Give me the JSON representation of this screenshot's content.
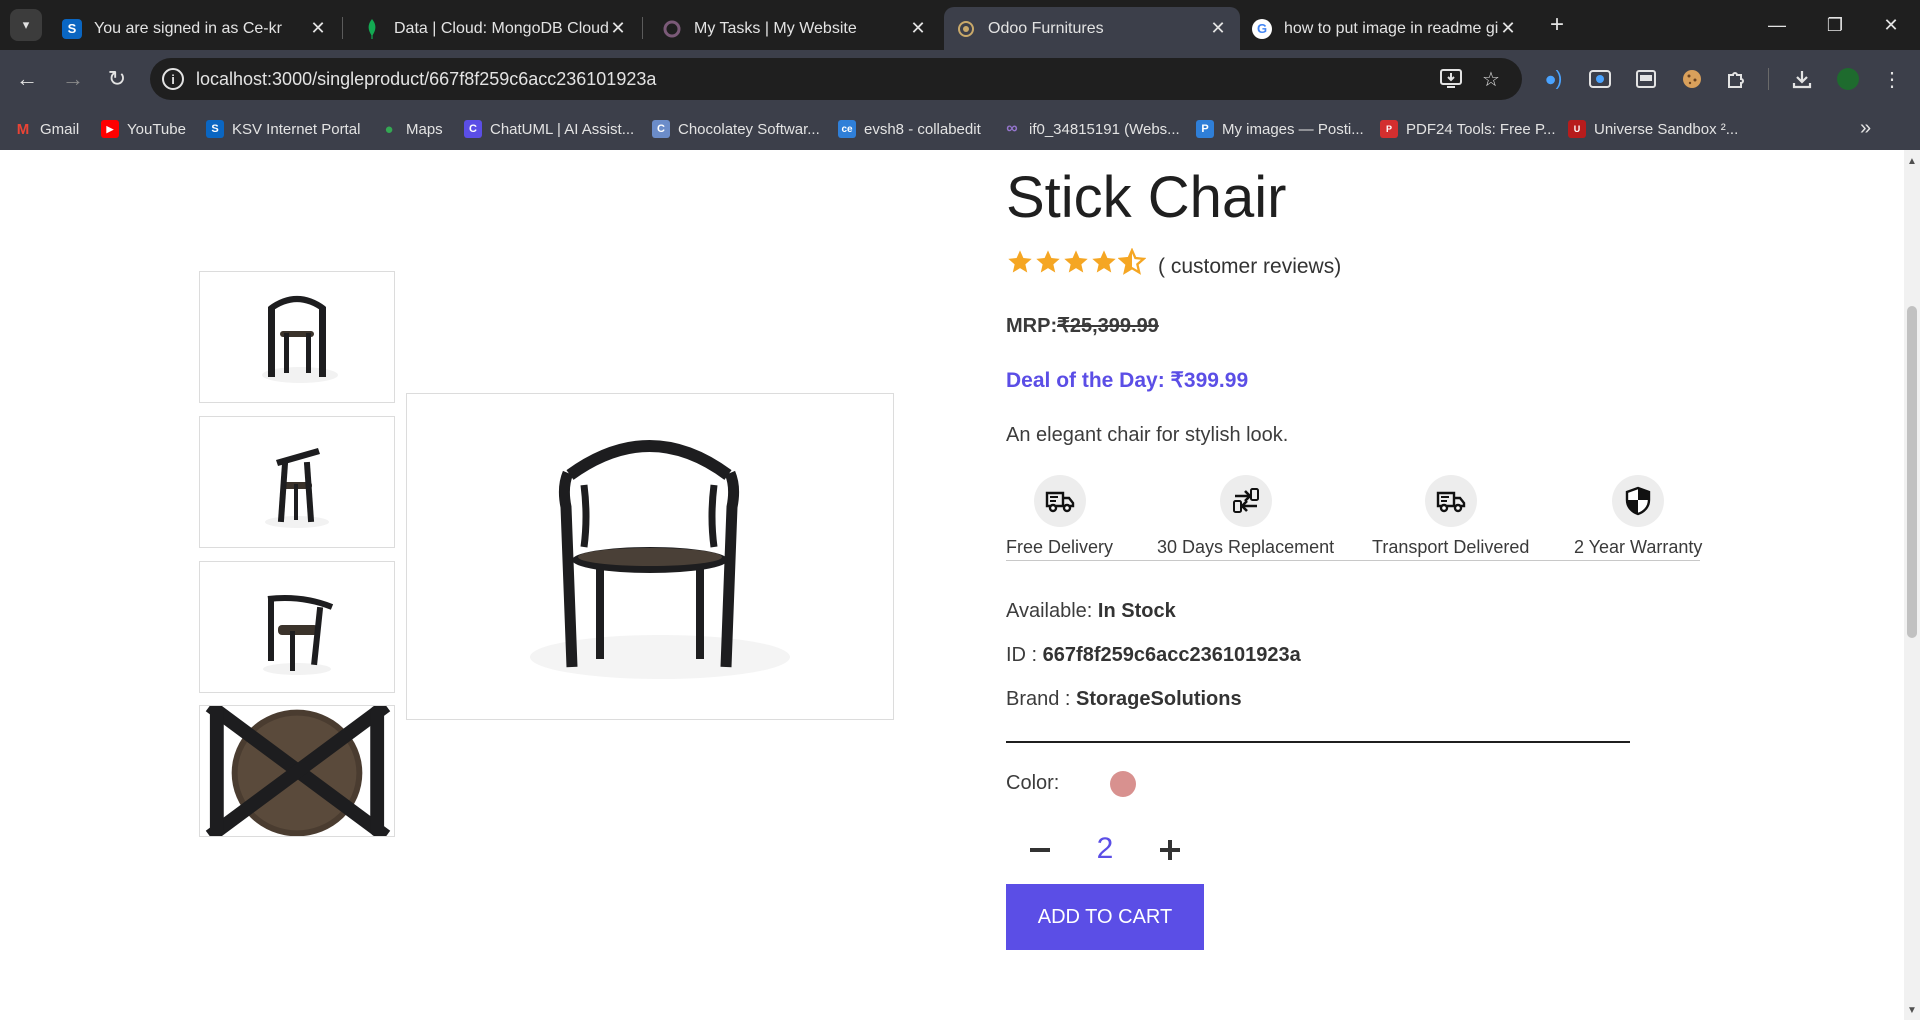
{
  "browser": {
    "tabs": [
      {
        "title": "You are signed in as Ce-kr",
        "favicon_text": "S",
        "favicon_color": "#0a66c2",
        "active": false
      },
      {
        "title": "Data | Cloud: MongoDB Cloud",
        "favicon_text": "",
        "favicon_color": "#13aa52",
        "active": false
      },
      {
        "title": "My Tasks | My Website",
        "favicon_text": "",
        "favicon_color": "#7b5a78",
        "active": false
      },
      {
        "title": "Odoo Furnitures",
        "favicon_text": "",
        "favicon_color": "#c9a96a",
        "active": true
      },
      {
        "title": "how to put image in readme gi",
        "favicon_text": "G",
        "favicon_color": "#ffffff",
        "active": false
      }
    ],
    "new_tab_label": "+",
    "url": "localhost:3000/singleproduct/667f8f259c6acc236101923a",
    "bookmarks": [
      {
        "label": "Gmail",
        "icon_text": "M",
        "icon_color": "#ea4335"
      },
      {
        "label": "YouTube",
        "icon_text": "▶",
        "icon_color": "#ff0000"
      },
      {
        "label": "KSV Internet Portal",
        "icon_text": "S",
        "icon_color": "#0a66c2"
      },
      {
        "label": "Maps",
        "icon_text": "●",
        "icon_color": "#34a853"
      },
      {
        "label": "ChatUML | AI Assist...",
        "icon_text": "C",
        "icon_color": "#5b4ee6"
      },
      {
        "label": "Chocolatey Softwar...",
        "icon_text": "C",
        "icon_color": "#6b8cc9"
      },
      {
        "label": "evsh8 - collabedit",
        "icon_text": "ce",
        "icon_color": "#2f7fd8"
      },
      {
        "label": "if0_34815191 (Webs...",
        "icon_text": "∞",
        "icon_color": "#7e57c2"
      },
      {
        "label": "My images — Posti...",
        "icon_text": "P",
        "icon_color": "#2f7fd8"
      },
      {
        "label": "PDF24 Tools: Free P...",
        "icon_text": "P",
        "icon_color": "#d32f2f"
      },
      {
        "label": "Universe Sandbox ²...",
        "icon_text": "U",
        "icon_color": "#b71c1c"
      }
    ]
  },
  "colors": {
    "accent": "#5b4ee6",
    "star": "#f5a623",
    "swatch": "#d8918f"
  },
  "product": {
    "title": "Stick Chair",
    "rating": 4.5,
    "rating_max": 5,
    "reviews_text": "( customer reviews)",
    "mrp_label": "MRP:",
    "mrp_value": "₹25,399.99",
    "deal_text": "Deal of the Day: ₹399.99",
    "description": "An elegant chair for stylish look.",
    "features": [
      {
        "label": "Free Delivery",
        "icon": "truck-icon"
      },
      {
        "label": "30 Days Replacement",
        "icon": "replacement-icon"
      },
      {
        "label": "Transport Delivered",
        "icon": "truck-icon"
      },
      {
        "label": "2 Year Warranty",
        "icon": "shield-icon"
      }
    ],
    "available_label": "Available: ",
    "available_value": "In Stock",
    "id_label": "ID : ",
    "id_value": "667f8f259c6acc236101923a",
    "brand_label": "Brand : ",
    "brand_value": "StorageSolutions",
    "color_label": "Color:",
    "quantity": "2",
    "add_to_cart_label": "ADD TO CART"
  }
}
